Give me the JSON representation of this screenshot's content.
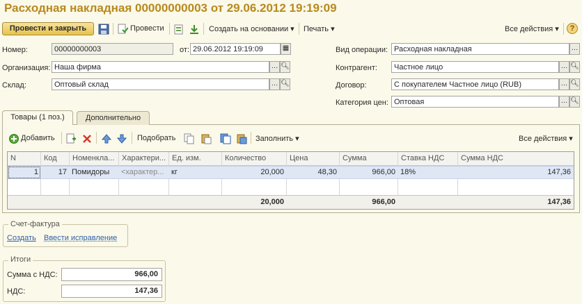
{
  "title": "Расходная накладная 00000000003 от 29.06.2012 19:19:09",
  "toolbar": {
    "post_close": "Провести и закрыть",
    "post": "Провести",
    "create_based": "Создать на основании",
    "print": "Печать",
    "all_actions": "Все действия",
    "help": "?"
  },
  "form": {
    "number_label": "Номер:",
    "number_value": "00000000003",
    "date_label": "от:",
    "date_value": "29.06.2012 19:19:09",
    "org_label": "Организация:",
    "org_value": "Наша фирма",
    "warehouse_label": "Склад:",
    "warehouse_value": "Оптовый склад",
    "operation_label": "Вид операции:",
    "operation_value": "Расходная накладная",
    "contractor_label": "Контрагент:",
    "contractor_value": "Частное лицо",
    "contract_label": "Договор:",
    "contract_value": "С покупателем Частное лицо (RUB)",
    "price_cat_label": "Категория цен:",
    "price_cat_value": "Оптовая"
  },
  "tabs": [
    {
      "label": "Товары (1 поз.)"
    },
    {
      "label": "Дополнительно"
    }
  ],
  "table_toolbar": {
    "add": "Добавить",
    "select": "Подобрать",
    "fill": "Заполнить",
    "all_actions": "Все действия"
  },
  "table": {
    "columns": [
      "N",
      "Код",
      "Номенкла...",
      "Характери...",
      "Ед. изм.",
      "Количество",
      "Цена",
      "Сумма",
      "Ставка НДС",
      "Сумма НДС"
    ],
    "rows": [
      [
        "1",
        "17",
        "Помидоры",
        "<характер...",
        "кг",
        "20,000",
        "48,30",
        "966,00",
        "18%",
        "147,36"
      ]
    ],
    "footer": {
      "quantity": "20,000",
      "sum": "966,00",
      "vat_sum": "147,36"
    }
  },
  "invoice": {
    "legend": "Счет-фактура",
    "create": "Создать",
    "correction": "Ввести исправление"
  },
  "totals": {
    "legend": "Итоги",
    "sum_label": "Сумма с НДС:",
    "sum_value": "966,00",
    "vat_label": "НДС:",
    "vat_value": "147,36"
  }
}
